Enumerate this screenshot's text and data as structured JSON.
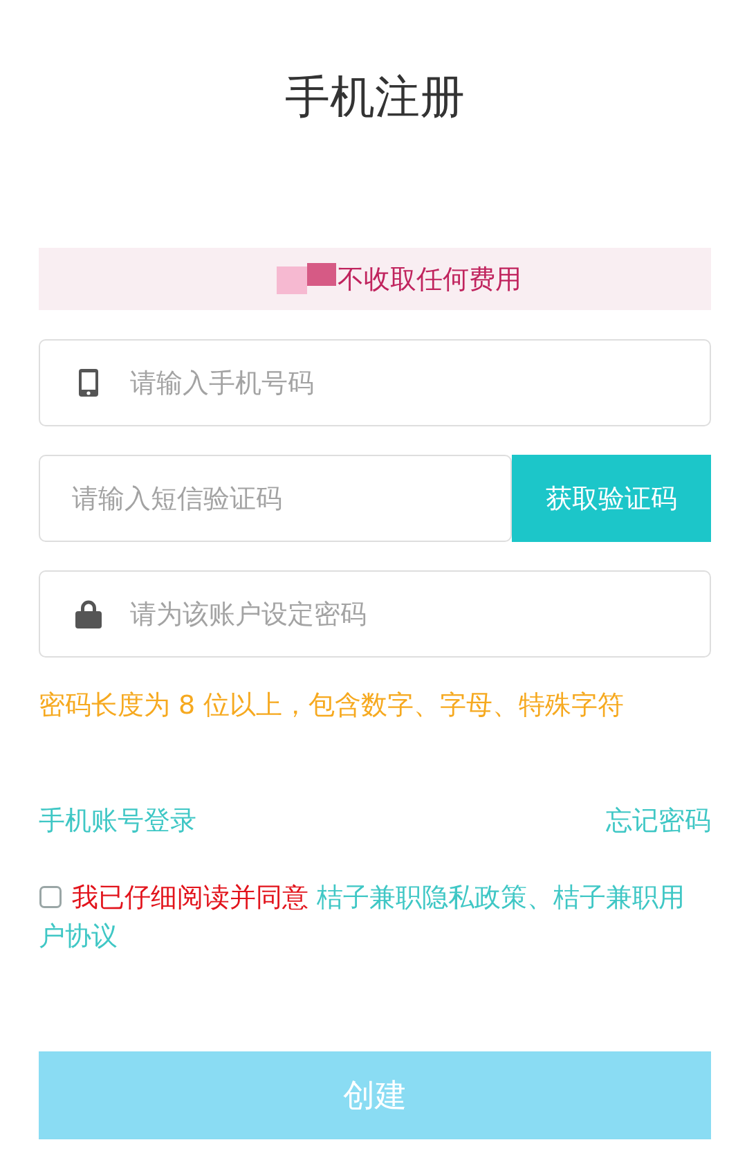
{
  "title": "手机注册",
  "notice": {
    "text": "不收取任何费用"
  },
  "fields": [
    {
      "kind": "phone",
      "placeholder": "请输入手机号码"
    },
    {
      "kind": "code",
      "placeholder": "请输入短信验证码",
      "button": "获取验证码"
    },
    {
      "kind": "password",
      "placeholder": "请为该账户设定密码"
    }
  ],
  "password_hint": "密码长度为 8 位以上，包含数字、字母、特殊字符",
  "links": {
    "phone_login": "手机账号登录",
    "forgot_password": "忘记密码"
  },
  "agreement": {
    "checked": false,
    "text": "我已仔细阅读并同意",
    "documents": "桔子兼职隐私政策、桔子兼职用户协议"
  },
  "submit_button": {
    "label": "创建",
    "disabled": true
  }
}
